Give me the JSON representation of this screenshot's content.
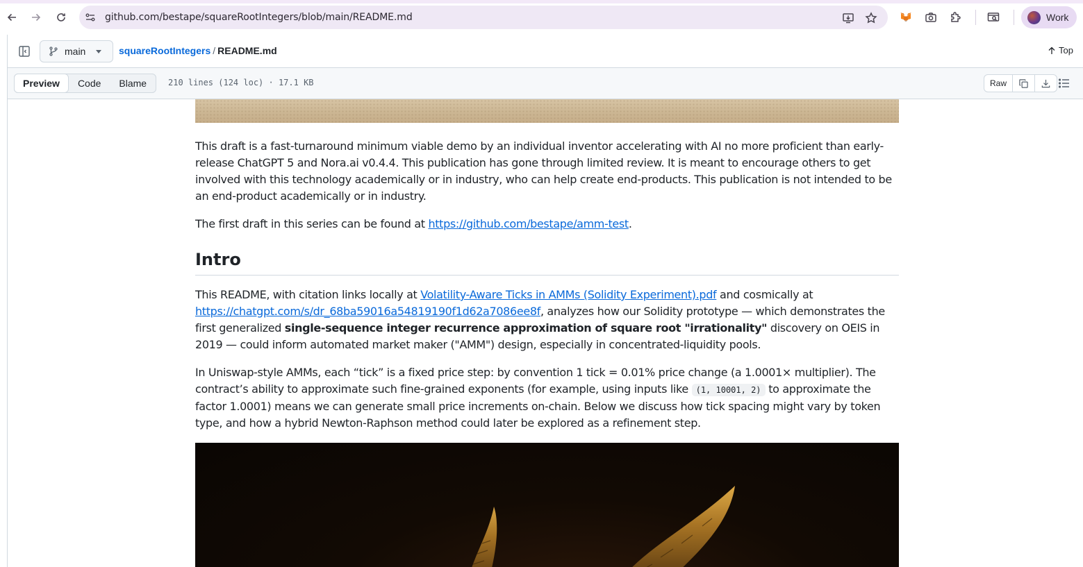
{
  "browser": {
    "url": "github.com/bestape/squareRootIntegers/blob/main/README.md",
    "profile_label": "Work",
    "icons": [
      "back-icon",
      "forward-icon",
      "reload-icon",
      "site-settings-icon",
      "install-icon",
      "star-icon",
      "metamask-icon",
      "camera-icon",
      "extensions-icon",
      "tab-search-icon"
    ]
  },
  "repo_header": {
    "branch": "main",
    "repo_name": "squareRootIntegers",
    "separator": "/",
    "file_name": "README.md",
    "top_label": "Top"
  },
  "file_toolbar": {
    "tabs": [
      "Preview",
      "Code",
      "Blame"
    ],
    "active_tab": "Preview",
    "meta": "210 lines (124 loc) · 17.1 KB",
    "raw_label": "Raw"
  },
  "article": {
    "p1": "This draft is a fast-turnaround minimum viable demo by an individual inventor accelerating with AI no more proficient than early-release ChatGPT 5 and Nora.ai v0.4.4. This publication has gone through limited review. It is meant to encourage others to get involved with this technology academically or in industry, who can help create end-products. This publication is not intended to be an end-product academically or in industry.",
    "p2_prefix": "The first draft in this series can be found at ",
    "p2_link": "https://github.com/bestape/amm-test",
    "p2_suffix": ".",
    "intro_heading": "Intro",
    "p3_a": "This README, with citation links locally at ",
    "p3_link1": "Volatility-Aware Ticks in AMMs (Solidity Experiment).pdf",
    "p3_b": " and cosmically at ",
    "p3_link2": "https://chatgpt.com/s/dr_68ba59016a54819190f1d62a7086ee8f",
    "p3_c": ", analyzes how our Solidity prototype — which demonstrates the first generalized ",
    "p3_bold": "single-sequence integer recurrence approximation of square root \"irrationality\"",
    "p3_d": " discovery on OEIS in 2019 — could inform automated market maker (\"AMM\") design, especially in concentrated-liquidity pools.",
    "p4_a": "In Uniswap-style AMMs, each “tick” is a fixed price step: by convention 1 tick = 0.01% price change (a 1.0001× multiplier). The contract’s ability to approximate such fine-grained exponents (for example, using inputs like ",
    "p4_code": "(1, 10001, 2)",
    "p4_b": " to approximate the factor 1.0001) means we can generate small price increments on-chain. Below we discuss how tick spacing might vary by token type, and how a hybrid Newton-Raphson method could later be explored as a refinement step."
  },
  "colors": {
    "link": "#0969da",
    "text": "#1f2328",
    "border": "#d1d9e0",
    "omnibox_bg": "#efe8f5",
    "profile_bg": "#e8dbf3"
  }
}
